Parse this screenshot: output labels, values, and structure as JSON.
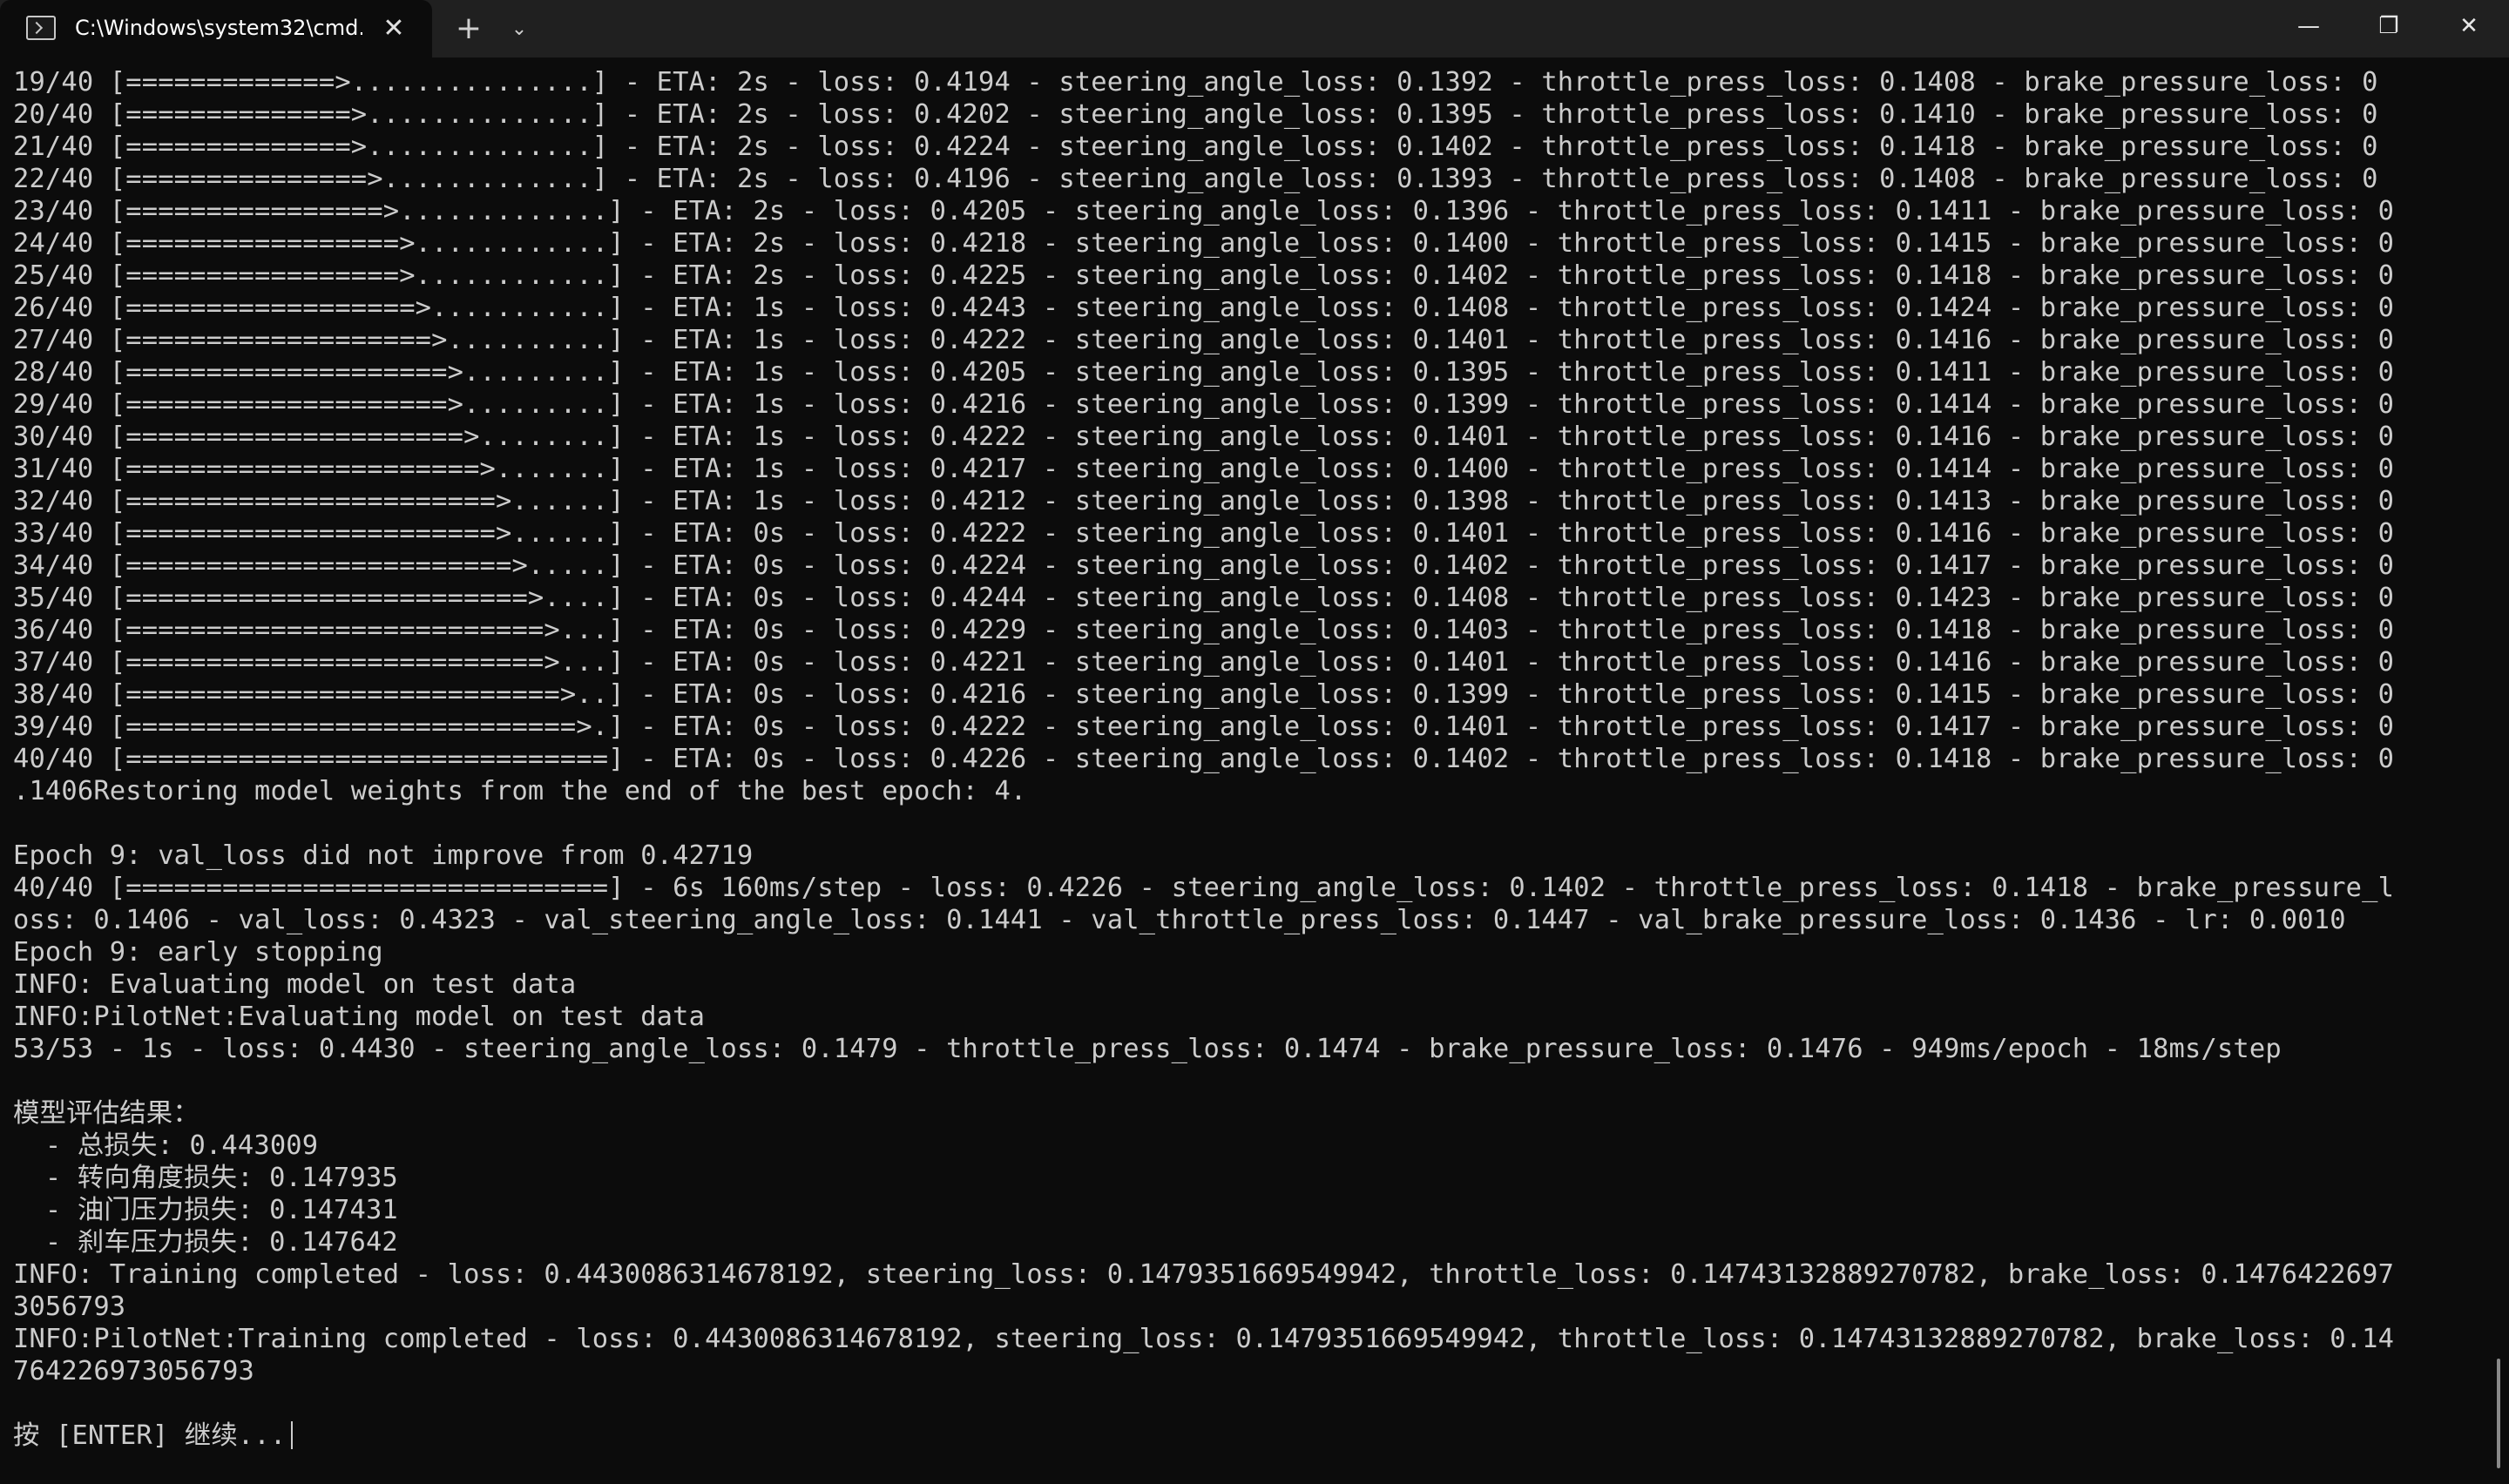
{
  "window": {
    "tab_title": "C:\\Windows\\system32\\cmd.e:",
    "tab_icon": "terminal-icon",
    "close_glyph": "✕",
    "new_tab_glyph": "+",
    "dropdown_glyph": "⌄",
    "minimize_glyph": "—",
    "maximize_glyph": "❐",
    "window_close_glyph": "✕"
  },
  "colors": {
    "background": "#0c0c0c",
    "titlebar": "#202020",
    "text": "#cccccc"
  },
  "terminal": {
    "lines": [
      "19/40 [=============>...............] - ETA: 2s - loss: 0.4194 - steering_angle_loss: 0.1392 - throttle_press_loss: 0.1408 - brake_pressure_loss: 0",
      "20/40 [==============>..............] - ETA: 2s - loss: 0.4202 - steering_angle_loss: 0.1395 - throttle_press_loss: 0.1410 - brake_pressure_loss: 0",
      "21/40 [==============>..............] - ETA: 2s - loss: 0.4224 - steering_angle_loss: 0.1402 - throttle_press_loss: 0.1418 - brake_pressure_loss: 0",
      "22/40 [===============>.............] - ETA: 2s - loss: 0.4196 - steering_angle_loss: 0.1393 - throttle_press_loss: 0.1408 - brake_pressure_loss: 0",
      "23/40 [================>.............] - ETA: 2s - loss: 0.4205 - steering_angle_loss: 0.1396 - throttle_press_loss: 0.1411 - brake_pressure_loss: 0",
      "24/40 [=================>............] - ETA: 2s - loss: 0.4218 - steering_angle_loss: 0.1400 - throttle_press_loss: 0.1415 - brake_pressure_loss: 0",
      "25/40 [=================>............] - ETA: 2s - loss: 0.4225 - steering_angle_loss: 0.1402 - throttle_press_loss: 0.1418 - brake_pressure_loss: 0",
      "26/40 [==================>...........] - ETA: 1s - loss: 0.4243 - steering_angle_loss: 0.1408 - throttle_press_loss: 0.1424 - brake_pressure_loss: 0",
      "27/40 [===================>..........] - ETA: 1s - loss: 0.4222 - steering_angle_loss: 0.1401 - throttle_press_loss: 0.1416 - brake_pressure_loss: 0",
      "28/40 [====================>.........] - ETA: 1s - loss: 0.4205 - steering_angle_loss: 0.1395 - throttle_press_loss: 0.1411 - brake_pressure_loss: 0",
      "29/40 [====================>.........] - ETA: 1s - loss: 0.4216 - steering_angle_loss: 0.1399 - throttle_press_loss: 0.1414 - brake_pressure_loss: 0",
      "30/40 [=====================>........] - ETA: 1s - loss: 0.4222 - steering_angle_loss: 0.1401 - throttle_press_loss: 0.1416 - brake_pressure_loss: 0",
      "31/40 [======================>.......] - ETA: 1s - loss: 0.4217 - steering_angle_loss: 0.1400 - throttle_press_loss: 0.1414 - brake_pressure_loss: 0",
      "32/40 [=======================>......] - ETA: 1s - loss: 0.4212 - steering_angle_loss: 0.1398 - throttle_press_loss: 0.1413 - brake_pressure_loss: 0",
      "33/40 [=======================>......] - ETA: 0s - loss: 0.4222 - steering_angle_loss: 0.1401 - throttle_press_loss: 0.1416 - brake_pressure_loss: 0",
      "34/40 [========================>.....] - ETA: 0s - loss: 0.4224 - steering_angle_loss: 0.1402 - throttle_press_loss: 0.1417 - brake_pressure_loss: 0",
      "35/40 [=========================>....] - ETA: 0s - loss: 0.4244 - steering_angle_loss: 0.1408 - throttle_press_loss: 0.1423 - brake_pressure_loss: 0",
      "36/40 [==========================>...] - ETA: 0s - loss: 0.4229 - steering_angle_loss: 0.1403 - throttle_press_loss: 0.1418 - brake_pressure_loss: 0",
      "37/40 [==========================>...] - ETA: 0s - loss: 0.4221 - steering_angle_loss: 0.1401 - throttle_press_loss: 0.1416 - brake_pressure_loss: 0",
      "38/40 [===========================>..] - ETA: 0s - loss: 0.4216 - steering_angle_loss: 0.1399 - throttle_press_loss: 0.1415 - brake_pressure_loss: 0",
      "39/40 [============================>.] - ETA: 0s - loss: 0.4222 - steering_angle_loss: 0.1401 - throttle_press_loss: 0.1417 - brake_pressure_loss: 0",
      "40/40 [==============================] - ETA: 0s - loss: 0.4226 - steering_angle_loss: 0.1402 - throttle_press_loss: 0.1418 - brake_pressure_loss: 0",
      ".1406Restoring model weights from the end of the best epoch: 4.",
      "",
      "Epoch 9: val_loss did not improve from 0.42719",
      "40/40 [==============================] - 6s 160ms/step - loss: 0.4226 - steering_angle_loss: 0.1402 - throttle_press_loss: 0.1418 - brake_pressure_l",
      "oss: 0.1406 - val_loss: 0.4323 - val_steering_angle_loss: 0.1441 - val_throttle_press_loss: 0.1447 - val_brake_pressure_loss: 0.1436 - lr: 0.0010",
      "Epoch 9: early stopping",
      "INFO: Evaluating model on test data",
      "INFO:PilotNet:Evaluating model on test data",
      "53/53 - 1s - loss: 0.4430 - steering_angle_loss: 0.1479 - throttle_press_loss: 0.1474 - brake_pressure_loss: 0.1476 - 949ms/epoch - 18ms/step",
      "",
      "模型评估结果：",
      "  - 总损失: 0.443009",
      "  - 转向角度损失: 0.147935",
      "  - 油门压力损失: 0.147431",
      "  - 刹车压力损失: 0.147642",
      "INFO: Training completed - loss: 0.4430086314678192, steering_loss: 0.1479351669549942, throttle_loss: 0.14743132889270782, brake_loss: 0.1476422697",
      "3056793",
      "INFO:PilotNet:Training completed - loss: 0.4430086314678192, steering_loss: 0.1479351669549942, throttle_loss: 0.14743132889270782, brake_loss: 0.14",
      "764226973056793",
      "",
      "按 [ENTER] 继续..."
    ]
  }
}
